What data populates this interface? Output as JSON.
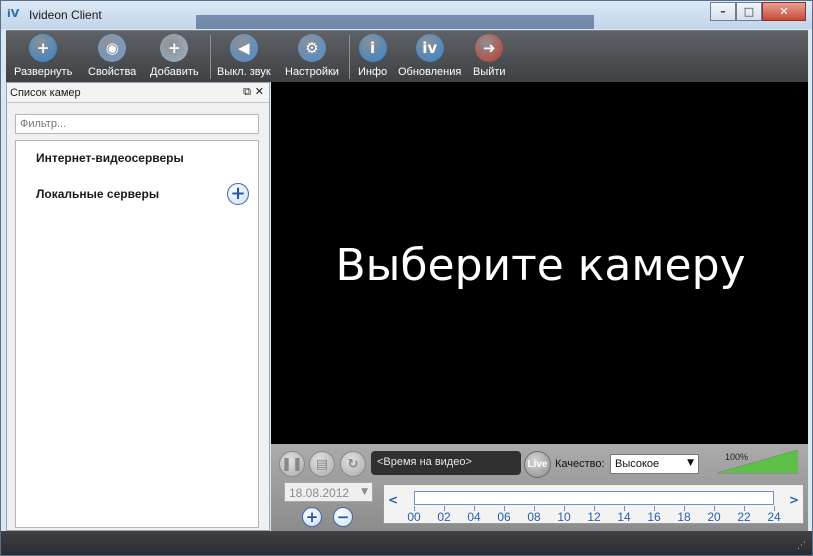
{
  "window": {
    "title": "Ivideon Client",
    "logo_text": "iV",
    "buttons": {
      "minimize": "–",
      "maximize": "□",
      "close": "✕"
    }
  },
  "toolbar": {
    "items": [
      {
        "label": "Развернуть",
        "icon": "expand-plus-icon",
        "color": "#2f86d6",
        "glyph": "+"
      },
      {
        "label": "Свойства",
        "icon": "camera-properties-icon",
        "color": "#6fa0d8",
        "glyph": "◉"
      },
      {
        "label": "Добавить",
        "icon": "add-camera-icon",
        "color": "#9fb4c7",
        "glyph": "+"
      },
      {
        "label": "Выкл. звук",
        "icon": "speaker-icon",
        "color": "#4a8fd6",
        "glyph": "◀"
      },
      {
        "label": "Настройки",
        "icon": "settings-gear-icon",
        "color": "#4a8fd6",
        "glyph": "⚙"
      },
      {
        "label": "Инфо",
        "icon": "info-icon",
        "color": "#2f86d6",
        "glyph": "i"
      },
      {
        "label": "Обновления",
        "icon": "update-iv-icon",
        "color": "#2f86d6",
        "glyph": "iv"
      },
      {
        "label": "Выйти",
        "icon": "exit-door-icon",
        "color": "#c23a2b",
        "glyph": "➜"
      }
    ]
  },
  "camera_panel": {
    "title": "Список камер",
    "float_icon": "⧉",
    "close_icon": "✕",
    "filter_placeholder": "Фильтр...",
    "groups": [
      {
        "label": "Интернет-видеосерверы"
      },
      {
        "label": "Локальные серверы"
      }
    ]
  },
  "video": {
    "message": "Выберите камеру"
  },
  "controls": {
    "time_placeholder": "<Время на видео>",
    "live_label": "Live",
    "quality_label": "Качество:",
    "quality_value": "Высокое",
    "level_text": "100%",
    "level_fraction": 1.0,
    "date_value": "18.08.2012",
    "timeline_hours": [
      "00",
      "02",
      "04",
      "06",
      "08",
      "10",
      "12",
      "14",
      "16",
      "18",
      "20",
      "22",
      "24"
    ],
    "colors": {
      "accent": "#2a5fa8"
    }
  }
}
